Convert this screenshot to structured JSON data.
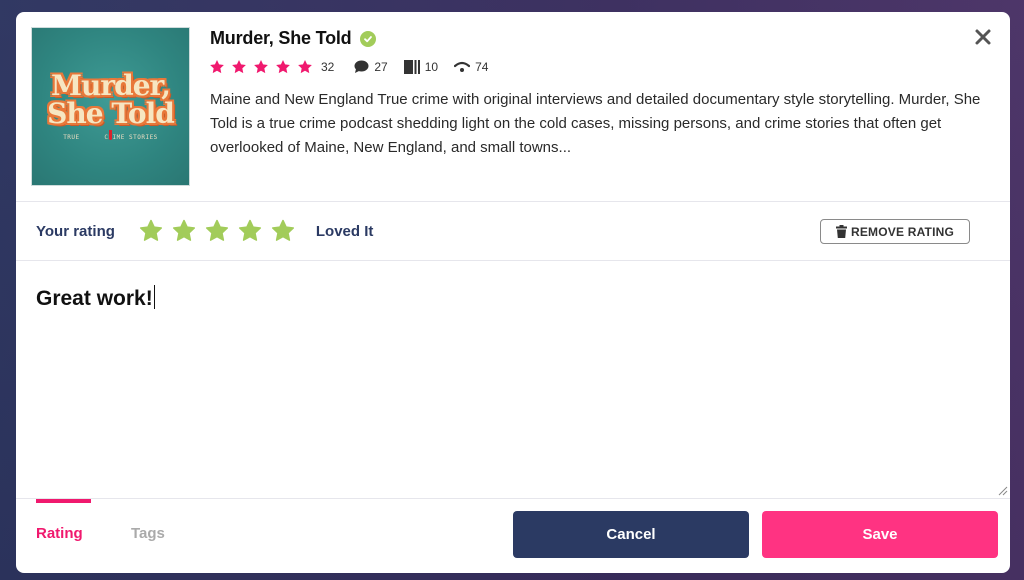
{
  "podcast": {
    "title": "Murder, She Told",
    "verified": true,
    "cover": {
      "title_line1": "Murder,",
      "title_line2": "She Told",
      "subtitle_left": "TRUE",
      "subtitle_right": "CRIME STORIES"
    },
    "stars": 5,
    "rating_count": "32",
    "comments_count": "27",
    "lists_count": "10",
    "followers_count": "74",
    "description": "Maine and New England True crime with original interviews and detailed documentary style storytelling. Murder, She Told is a true crime podcast shedding light on the cold cases, missing persons, and crime stories that often get overlooked of Maine, New England, and small towns..."
  },
  "icons": {
    "close": "close-icon",
    "verified": "check-circle-icon",
    "star": "star-icon",
    "comments": "comment-icon",
    "lists": "list-icon",
    "followers": "wifi-icon",
    "trash": "trash-icon"
  },
  "rating": {
    "label": "Your rating",
    "value": 5,
    "max": 5,
    "value_label": "Loved It",
    "remove_label": "REMOVE RATING"
  },
  "comment": {
    "value": "Great work!"
  },
  "tabs": [
    {
      "label": "Rating",
      "active": true
    },
    {
      "label": "Tags",
      "active": false
    }
  ],
  "actions": {
    "cancel_label": "Cancel",
    "save_label": "Save"
  },
  "colors": {
    "accent_pink": "#ff3382",
    "navy": "#2b3a63",
    "star_green": "#a2cc5a",
    "star_pink": "#f0196e"
  }
}
